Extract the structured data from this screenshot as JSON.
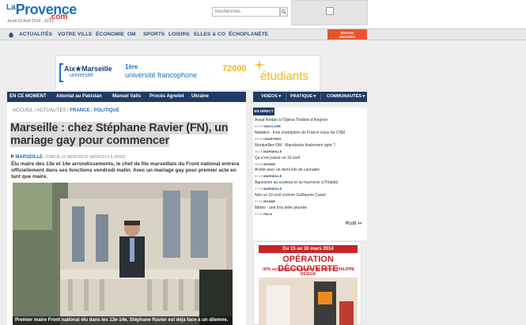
{
  "header": {
    "logo_la": "La",
    "logo_provence": "Provence",
    "logo_com": ".com",
    "date": "Jeudi 10 Avril 2014 - 10:01",
    "search_placeholder": "Recherches"
  },
  "nav": {
    "items": [
      "ACTUALITÉS",
      "VOTRE VILLE",
      "ÉCONOMIE",
      "OM",
      "SPORTS",
      "LOISIRS",
      "ELLES & CO",
      "ÉCHOPLANÈTE"
    ],
    "edition_line1": "ÉDITION",
    "edition_line2": "ABONNÉS"
  },
  "banner": {
    "aix": "Aix★Marseille",
    "univ": "université",
    "first": "1ère",
    "uf": "université francophone",
    "num": "72000",
    "etud": "étudiants"
  },
  "en_moment": {
    "label": "EN CE MOMENT",
    "links": [
      "Attentat au Pakistan",
      "Manuel Valls",
      "Procès Agnelet",
      "Ukraine"
    ]
  },
  "article": {
    "breadcrumb_pre": "ACCUEIL / ACTUALITÉS /",
    "breadcrumb_france": "FRANCE",
    "breadcrumb_sep": "/",
    "breadcrumb_pol": "POLITIQUE",
    "title_line1": "Marseille : chez Stéphane Ravier (FN), un",
    "title_line2": "mariage gay pour commencer",
    "byline_city": "MARSEILLE",
    "byline_rest": "/ PUBLIÉ LE MERCREDI 09/04/2014 À 05H32",
    "lede": "Élu maire des 13e et 14e arrondissements, le chef de file marseillais du Front national entrera officiellement dans ses fonctions vendredi matin. Avec un mariage gay pour premier acte en tant que maire.",
    "caption": "Premier maire Front national élu dans les 13e-14e, Stéphane Ravier est déjà face à un dilemne."
  },
  "right_menu": {
    "items": [
      "VIDÉOS",
      "PRATIQUE",
      "COMMUNAUTÉS"
    ]
  },
  "en_direct": {
    "label": "EN DIRECT",
    "news": [
      {
        "title": "Assaf Avidan à l'Opéra-Théâtre d'Avignon",
        "time": "09:43",
        "place": "VAUCLUSE"
      },
      {
        "title": "Natation : trois champions de France issus du CNM",
        "time": "09:09",
        "place": "CHARTRES"
      },
      {
        "title": "Montpellier-OM : Mandanda finalement apte ?",
        "time": "08:35",
        "place": "MARSEILLE"
      },
      {
        "title": "Ça s'est passé un 10 avril",
        "time": "08:05",
        "place": "MONDE"
      },
      {
        "title": "Arrêté avec un demi kilo de cannabis",
        "time": "07:19",
        "place": "MARSEILLE"
      },
      {
        "title": "Agression au couteau et au tournevis à l'hôpital",
        "time": "07:19",
        "place": "MARSEILLE"
      },
      {
        "title": "Nés un 10 avril comme Guillaume Canet",
        "time": "07:10",
        "place": "MONDE"
      },
      {
        "title": "Météo : une très belle journée",
        "time": "07:00",
        "place": "PACA"
      }
    ],
    "plus": "PLUS >>"
  },
  "ad": {
    "top": "Du 15 au 30 mars 2014",
    "title": "OPÉRATION DÉCOUVERTE",
    "sub": "-30% sur la nouvelle gamme de poêles* PHILIPPE DESIGN"
  },
  "colors": {
    "brand_blue": "#1d70b8",
    "brand_red": "#e7222d",
    "nav_dark": "#1f3b66",
    "edition_orange": "#e8542a"
  }
}
